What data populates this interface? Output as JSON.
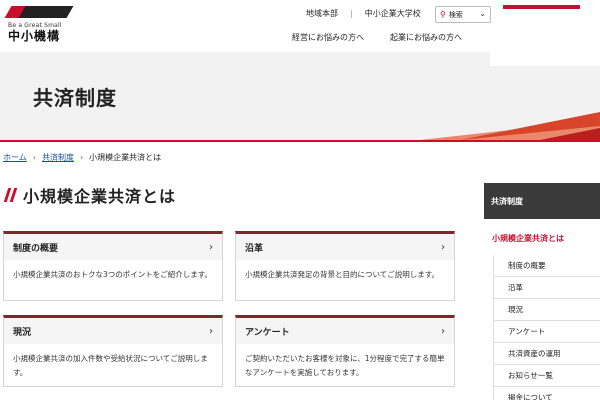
{
  "header": {
    "logo_tagline": "Be a Great Small",
    "logo_text": "中小機構",
    "util_links": [
      "地域本部",
      "中小企業大学校"
    ],
    "search_label": "検索",
    "main_nav": [
      "経営にお悩みの方へ",
      "起業にお悩みの方へ"
    ]
  },
  "hero": {
    "title": "共済制度"
  },
  "breadcrumb": {
    "home": "ホーム",
    "parent": "共済制度",
    "current": "小規模企業共済とは"
  },
  "page": {
    "title": "小規模企業共済とは"
  },
  "cards": [
    {
      "title": "制度の概要",
      "desc": "小規模企業共済のおトクな3つのポイントをご紹介します。"
    },
    {
      "title": "沿革",
      "desc": "小規模企業共済発足の背景と目的についてご説明します。"
    },
    {
      "title": "現況",
      "desc": "小規模企業共済の加入件数や受給状況についてご説明します。"
    },
    {
      "title": "アンケート",
      "desc": "ご契約いただいたお客様を対象に、1分程度で完了する簡単なアンケートを実施しております。"
    }
  ],
  "sidebar": {
    "heading": "共済制度",
    "active": "小規模企業共済とは",
    "items": [
      "制度の概要",
      "沿革",
      "現況",
      "アンケート",
      "共済資産の運用",
      "お知らせ一覧",
      "掲金について"
    ]
  },
  "colors": {
    "brand_red": "#c8102e",
    "dark": "#3a3a3a",
    "link": "#1a4fa0"
  }
}
